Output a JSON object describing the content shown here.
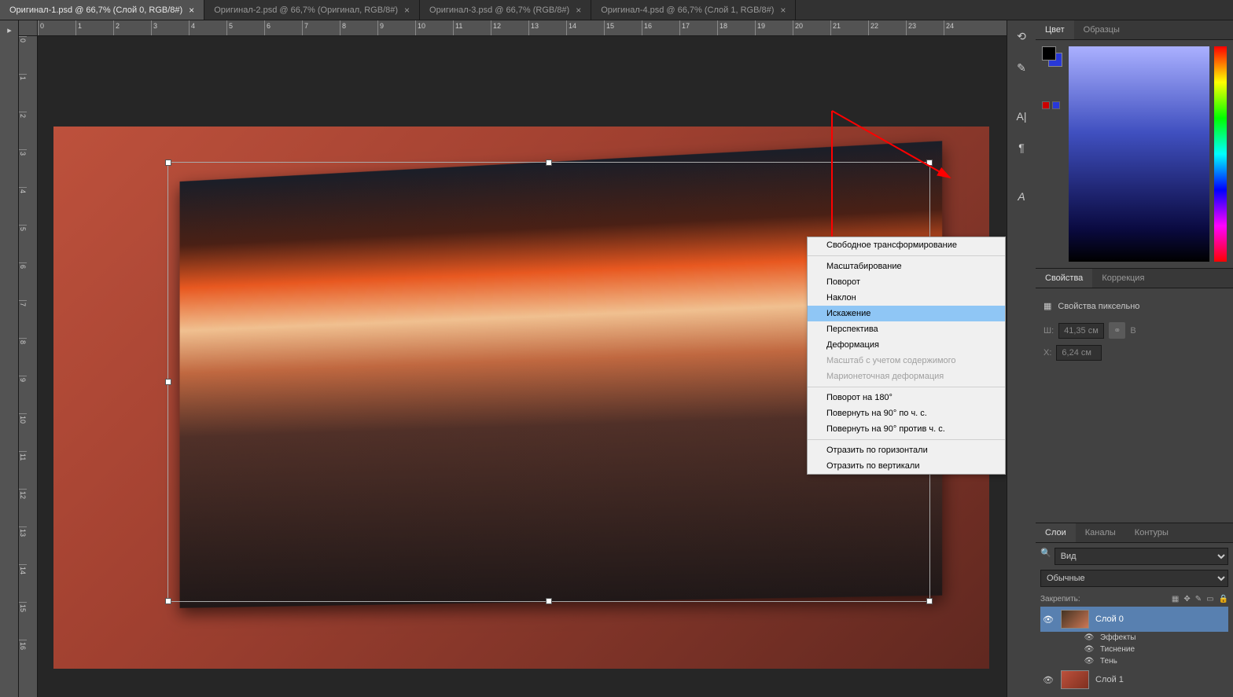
{
  "tabs": [
    {
      "label": "Оригинал-1.psd @ 66,7% (Слой 0, RGB/8#)",
      "active": true
    },
    {
      "label": "Оригинал-2.psd @ 66,7% (Оригинал, RGB/8#)",
      "active": false
    },
    {
      "label": "Оригинал-3.psd @ 66,7% (RGB/8#)",
      "active": false
    },
    {
      "label": "Оригинал-4.psd @ 66,7% (Слой 1, RGB/8#)",
      "active": false
    }
  ],
  "ruler_h": [
    "0",
    "1",
    "2",
    "3",
    "4",
    "5",
    "6",
    "7",
    "8",
    "9",
    "10",
    "11",
    "12",
    "13",
    "14",
    "15",
    "16",
    "17",
    "18",
    "19",
    "20",
    "21",
    "22",
    "23",
    "24"
  ],
  "ruler_v": [
    "0",
    "1",
    "2",
    "3",
    "4",
    "5",
    "6",
    "7",
    "8",
    "9",
    "10",
    "11",
    "12",
    "13",
    "14",
    "15",
    "16"
  ],
  "context_menu": {
    "items": [
      {
        "label": "Свободное трансформирование",
        "type": "item"
      },
      {
        "type": "sep"
      },
      {
        "label": "Масштабирование",
        "type": "item"
      },
      {
        "label": "Поворот",
        "type": "item"
      },
      {
        "label": "Наклон",
        "type": "item"
      },
      {
        "label": "Искажение",
        "type": "item",
        "highlighted": true
      },
      {
        "label": "Перспектива",
        "type": "item"
      },
      {
        "label": "Деформация",
        "type": "item"
      },
      {
        "label": "Масштаб с учетом содержимого",
        "type": "item",
        "disabled": true
      },
      {
        "label": "Марионеточная деформация",
        "type": "item",
        "disabled": true
      },
      {
        "type": "sep"
      },
      {
        "label": "Поворот на 180°",
        "type": "item"
      },
      {
        "label": "Повернуть на 90° по ч. с.",
        "type": "item"
      },
      {
        "label": "Повернуть на 90° против ч. с.",
        "type": "item"
      },
      {
        "type": "sep"
      },
      {
        "label": "Отразить по горизонтали",
        "type": "item"
      },
      {
        "label": "Отразить по вертикали",
        "type": "item"
      }
    ]
  },
  "color_tabs": {
    "tab1": "Цвет",
    "tab2": "Образцы"
  },
  "properties": {
    "tab1": "Свойства",
    "tab2": "Коррекция",
    "header": "Свойства пиксельно",
    "w_label": "Ш:",
    "w_value": "41,35 см",
    "x_label": "X:",
    "x_value": "6,24 см",
    "link": "⚭"
  },
  "layers": {
    "tab1": "Слои",
    "tab2": "Каналы",
    "tab3": "Контуры",
    "filter_label": "Вид",
    "search_icon": "🔍",
    "blend": "Обычные",
    "lock_label": "Закрепить:",
    "items": [
      {
        "name": "Слой 0",
        "selected": true
      },
      {
        "name": "Слой 1",
        "selected": false
      }
    ],
    "effects_label": "Эффекты",
    "effect1": "Тиснение",
    "effect2": "Тень"
  }
}
